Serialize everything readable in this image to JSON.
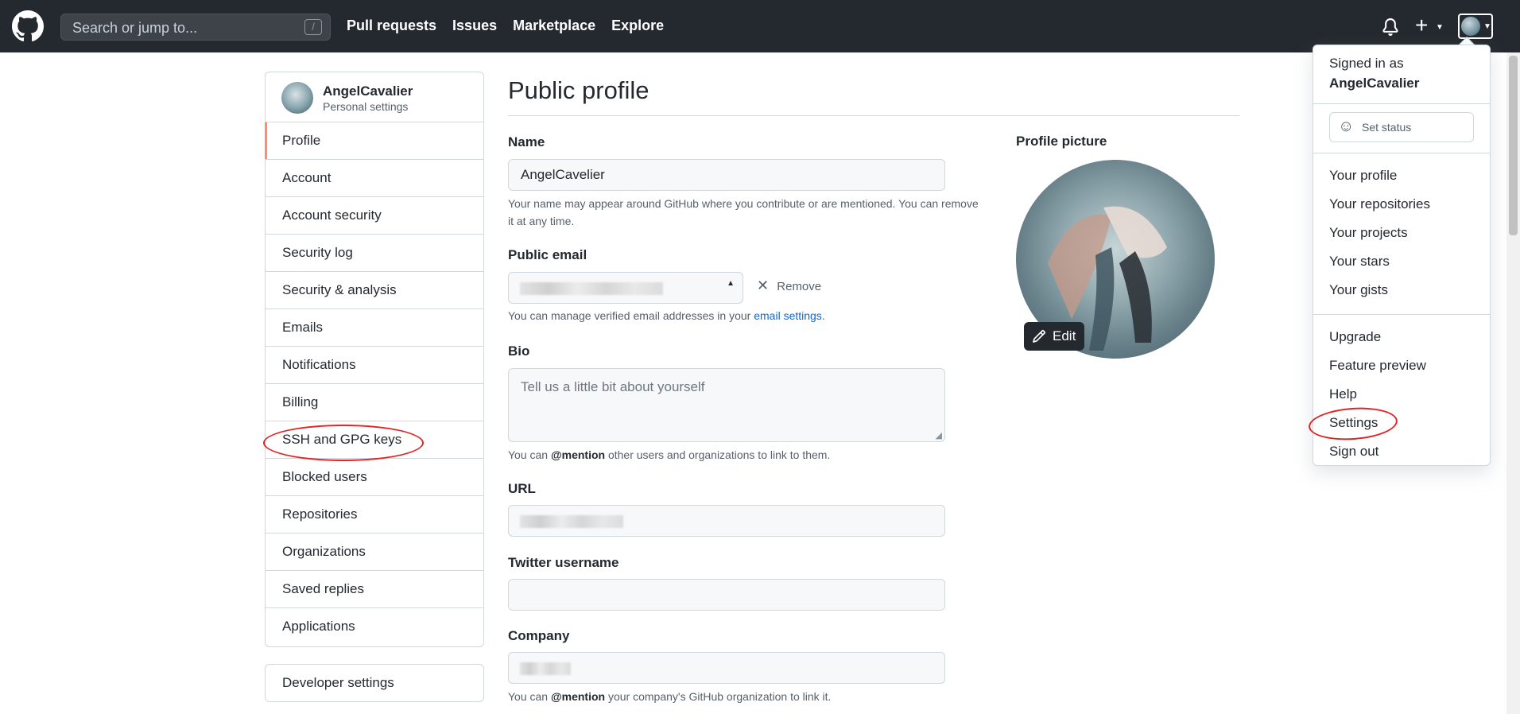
{
  "header": {
    "search_placeholder": "Search or jump to...",
    "search_shortcut": "/",
    "nav": [
      "Pull requests",
      "Issues",
      "Marketplace",
      "Explore"
    ],
    "plus_label": "+"
  },
  "sidebar": {
    "username": "AngelCavalier",
    "subtitle": "Personal settings",
    "items": [
      "Profile",
      "Account",
      "Account security",
      "Security log",
      "Security & analysis",
      "Emails",
      "Notifications",
      "Billing",
      "SSH and GPG keys",
      "Blocked users",
      "Repositories",
      "Organizations",
      "Saved replies",
      "Applications"
    ],
    "active": "Profile",
    "developer_settings": "Developer settings"
  },
  "main": {
    "title": "Public profile",
    "name_label": "Name",
    "name_value": "AngelCavelier",
    "name_note": "Your name may appear around GitHub where you contribute or are mentioned. You can remove it at any time.",
    "email_label": "Public email",
    "remove_label": "Remove",
    "email_note_prefix": "You can manage verified email addresses in your ",
    "email_note_link": "email settings",
    "email_note_suffix": ".",
    "bio_label": "Bio",
    "bio_placeholder": "Tell us a little bit about yourself",
    "bio_note_prefix": "You can ",
    "bio_note_bold": "@mention",
    "bio_note_suffix": " other users and organizations to link to them.",
    "url_label": "URL",
    "twitter_label": "Twitter username",
    "company_label": "Company",
    "company_note_prefix": "You can ",
    "company_note_bold": "@mention",
    "company_note_suffix": " your company's GitHub organization to link it.",
    "profile_picture_label": "Profile picture",
    "edit_label": "Edit"
  },
  "dropdown": {
    "signed_in_as": "Signed in as",
    "username": "AngelCavalier",
    "set_status": "Set status",
    "group1": [
      "Your profile",
      "Your repositories",
      "Your projects",
      "Your stars",
      "Your gists"
    ],
    "group2": [
      "Upgrade",
      "Feature preview",
      "Help",
      "Settings",
      "Sign out"
    ]
  },
  "colors": {
    "header_bg": "#24292f",
    "active_marker": "#fd8c73",
    "link": "#0969da",
    "annotation": "#e02424"
  }
}
